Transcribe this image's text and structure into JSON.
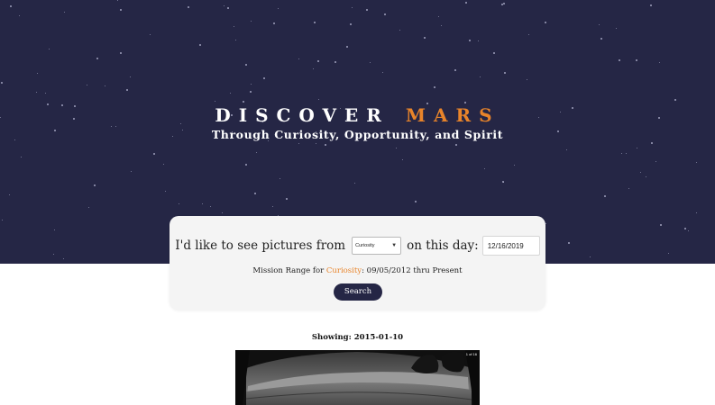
{
  "hero": {
    "title_word1": "DISCOVER",
    "title_word2": "MARS",
    "subtitle": "Through Curiosity, Opportunity, and Spirit",
    "background_color": "#252645",
    "accent_color": "#e8842a"
  },
  "search": {
    "prefix": "I'd like to see pictures from",
    "rover_selected": "Curiosity",
    "middle": "on this day:",
    "date_value": "12/16/2019",
    "mission_range_prefix": "Mission Range for",
    "mission_range_rover": "Curiosity",
    "mission_range_suffix": ": 09/05/2012 thru Present",
    "button_label": "Search"
  },
  "results": {
    "showing_label": "Showing:",
    "showing_date": "2015-01-10",
    "photo_counter": "1 of 16"
  }
}
